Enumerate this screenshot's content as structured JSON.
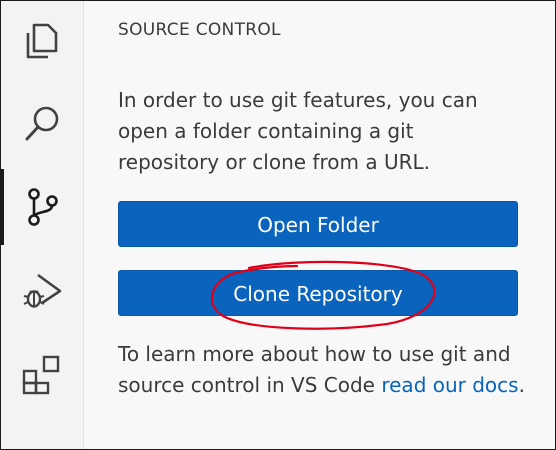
{
  "activity_bar": {
    "items": [
      {
        "icon": "files-icon"
      },
      {
        "icon": "search-icon"
      },
      {
        "icon": "source-control-icon",
        "active": true
      },
      {
        "icon": "run-debug-icon"
      },
      {
        "icon": "extensions-icon"
      }
    ]
  },
  "sidebar": {
    "title": "SOURCE CONTROL",
    "welcome_text": "In order to use git features, you can open a folder containing a git repository or clone from a URL.",
    "open_folder_label": "Open Folder",
    "clone_repository_label": "Clone Repository",
    "learn_text": "To learn more about how to use git and source control in VS Code ",
    "learn_link_text": "read our docs",
    "learn_suffix": "."
  },
  "colors": {
    "button_bg": "#0a63bd",
    "link": "#0a63bd",
    "annotation": "#e0001a"
  }
}
